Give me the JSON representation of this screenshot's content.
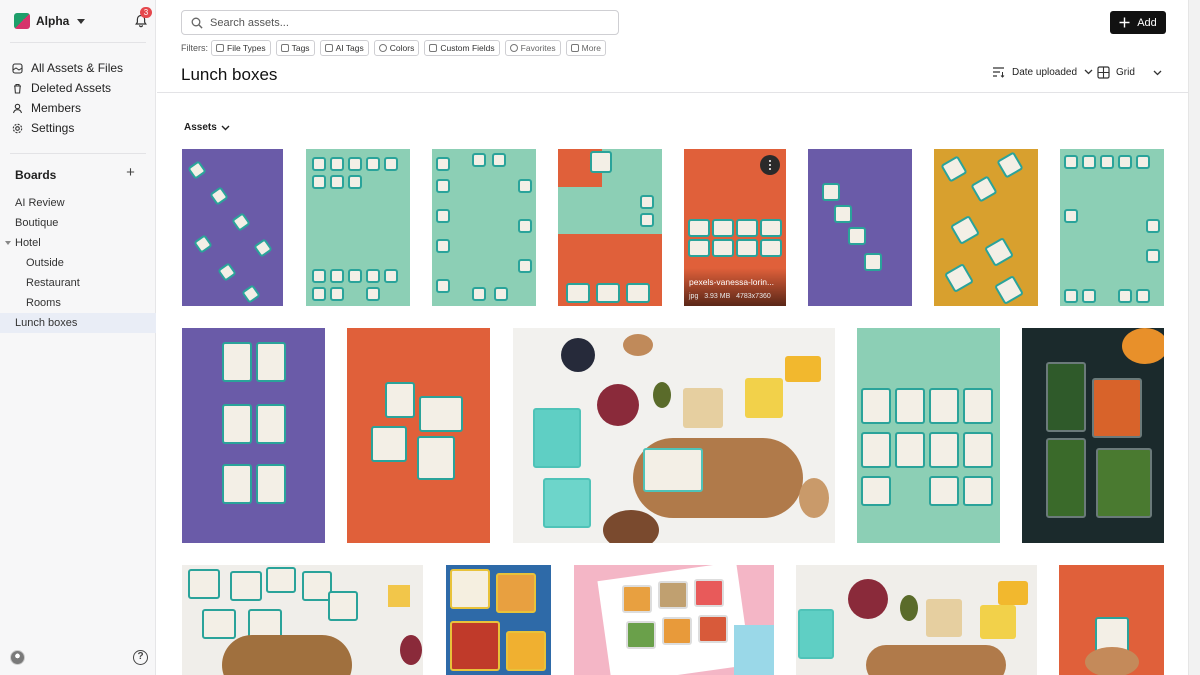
{
  "workspace": {
    "name": "Alpha",
    "notification_count": "3"
  },
  "sidebar": {
    "nav": [
      {
        "label": "All Assets & Files",
        "icon": "assets-icon"
      },
      {
        "label": "Deleted Assets",
        "icon": "trash-icon"
      },
      {
        "label": "Members",
        "icon": "user-icon"
      },
      {
        "label": "Settings",
        "icon": "gear-icon"
      }
    ],
    "boards_title": "Boards",
    "boards": [
      {
        "label": "AI Review"
      },
      {
        "label": "Boutique"
      },
      {
        "label": "Hotel",
        "expanded": true
      },
      {
        "label": "Outside"
      },
      {
        "label": "Restaurant"
      },
      {
        "label": "Rooms"
      },
      {
        "label": "Lunch boxes",
        "selected": true
      }
    ]
  },
  "search": {
    "placeholder": "Search assets..."
  },
  "toolbar": {
    "add_label": "Add"
  },
  "filters": {
    "label": "Filters:",
    "chips": [
      "File Types",
      "Tags",
      "AI Tags",
      "Colors",
      "Custom Fields",
      "Favorites",
      "More"
    ]
  },
  "page": {
    "title": "Lunch boxes"
  },
  "sort": {
    "label": "Date uploaded"
  },
  "view": {
    "label": "Grid"
  },
  "assets_section": {
    "label": "Assets"
  },
  "hovered_asset": {
    "name": "pexels-vanessa-lorin...",
    "type": "jpg",
    "size": "3.93 MB",
    "dimensions": "4783x7360"
  },
  "colors": {
    "accent": "#111111",
    "badge": "#e5484d",
    "purple": "#6a5ba8",
    "mint": "#8ccfb5",
    "orange": "#e0603a",
    "mustard": "#d8a02e",
    "dark": "#1b2a2c",
    "teal_box": "#2aa39a"
  }
}
